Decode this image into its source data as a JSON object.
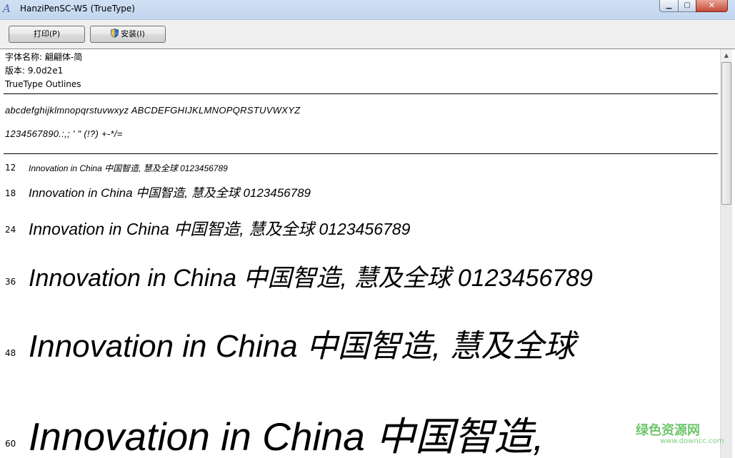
{
  "window": {
    "title": "HanziPenSC-W5 (TrueType)",
    "app_icon_glyph": "A",
    "controls": {
      "minimize_glyph": "▁",
      "maximize_glyph": "▢",
      "close_glyph": "✕"
    }
  },
  "toolbar": {
    "print_label": "打印(P)",
    "install_label": "安装(I)"
  },
  "font_info": {
    "name_line": "字体名称: 翩翩体-简",
    "version_line": "版本: 9.0d2e1",
    "type_line": "TrueType Outlines"
  },
  "charset": {
    "letters": "abcdefghijklmnopqrstuvwxyz ABCDEFGHIJKLMNOPQRSTUVWXYZ",
    "digits_symbols": "1234567890.:,; ' \" (!?) +-*/="
  },
  "samples": [
    {
      "size": "12",
      "text": "Innovation in China 中国智造, 慧及全球 0123456789"
    },
    {
      "size": "18",
      "text": "Innovation in China 中国智造, 慧及全球 0123456789"
    },
    {
      "size": "24",
      "text": "Innovation in China 中国智造, 慧及全球 0123456789"
    },
    {
      "size": "36",
      "text": "Innovation in China 中国智造, 慧及全球 0123456789"
    },
    {
      "size": "48",
      "text": "Innovation in China 中国智造, 慧及全球"
    },
    {
      "size": "60",
      "text": "Innovation in China 中国智造,"
    }
  ],
  "scrollbar": {
    "up_glyph": "▲"
  },
  "watermark": {
    "text": "绿色资源网",
    "sub": "www.downcc.com"
  },
  "colors": {
    "titlebar": "#c8dcf0",
    "close_button": "#c44a36",
    "watermark": "#4bb84a"
  }
}
